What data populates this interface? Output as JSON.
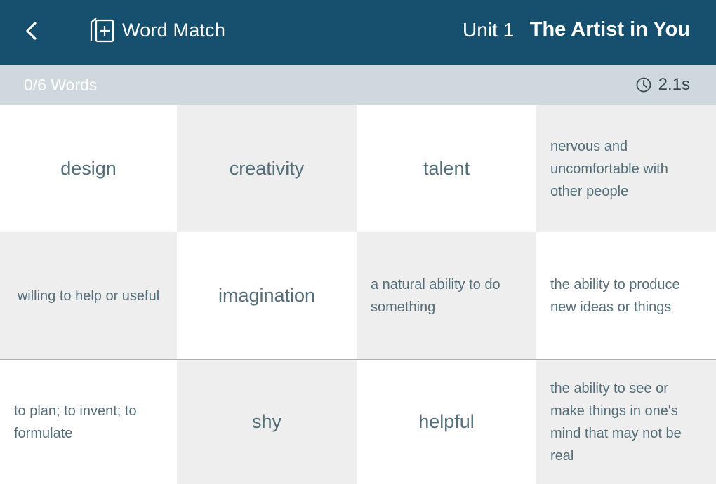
{
  "header": {
    "back_icon": "chevron-left-icon",
    "app_icon": "add-card-icon",
    "app_title": "Word Match",
    "unit_label": "Unit 1",
    "unit_title": "The Artist in You",
    "background_color": "#174f6e"
  },
  "status": {
    "word_count": "0/6 Words",
    "timer_icon": "clock-icon",
    "timer": "2.1s"
  },
  "cards": [
    {
      "text": "design",
      "kind": "word"
    },
    {
      "text": "creativity",
      "kind": "word"
    },
    {
      "text": "talent",
      "kind": "word"
    },
    {
      "text": "nervous and uncomfortable with other people",
      "kind": "definition"
    },
    {
      "text": "willing to help or useful",
      "kind": "definition"
    },
    {
      "text": "imagination",
      "kind": "word"
    },
    {
      "text": "a natural ability to do something",
      "kind": "definition"
    },
    {
      "text": "the ability to produce new ideas or things",
      "kind": "definition"
    },
    {
      "text": "to plan; to invent; to formulate",
      "kind": "definition"
    },
    {
      "text": "shy",
      "kind": "word"
    },
    {
      "text": "helpful",
      "kind": "word"
    },
    {
      "text": "the ability to see or make things in one's mind that may not be real",
      "kind": "definition"
    }
  ]
}
